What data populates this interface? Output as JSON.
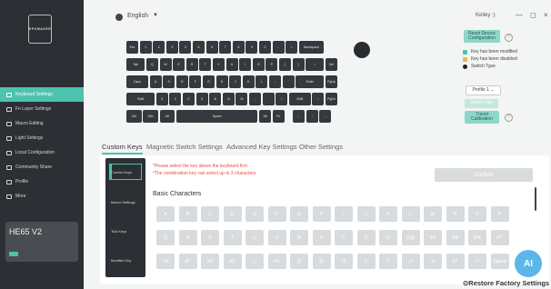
{
  "header": {
    "language": "English",
    "username": "Kelley :)"
  },
  "sidebar": {
    "logo_text": "EPOMAKER",
    "items": [
      {
        "label": "Keyboard Settings",
        "active": true
      },
      {
        "label": "Fn Layer Settings",
        "active": false
      },
      {
        "label": "Macro Editing",
        "active": false
      },
      {
        "label": "Light Settings",
        "active": false
      },
      {
        "label": "Local Configuration",
        "active": false
      },
      {
        "label": "Community Share",
        "active": false
      },
      {
        "label": "Profile",
        "active": false
      },
      {
        "label": "More",
        "active": false
      }
    ],
    "device": "HE65 V2"
  },
  "keyboard": {
    "rows": [
      [
        "Esc",
        "1",
        "2",
        "3",
        "4",
        "5",
        "6",
        "7",
        "8",
        "9",
        "0",
        "-",
        "=",
        "Backspace"
      ],
      [
        "Tab",
        "Q",
        "W",
        "E",
        "R",
        "T",
        "Y",
        "U",
        "I",
        "O",
        "P",
        "[",
        "]",
        "\\",
        "Del"
      ],
      [
        "Caps",
        "A",
        "S",
        "D",
        "F",
        "G",
        "H",
        "J",
        "K",
        "L",
        ";",
        "'",
        "Enter",
        "PgUp"
      ],
      [
        "Shift",
        "Z",
        "X",
        "C",
        "V",
        "B",
        "N",
        "M",
        ",",
        ".",
        "/",
        "Shift",
        "↑",
        "PgDn"
      ],
      [
        "Ctrl",
        "Win",
        "Alt",
        "Space",
        "Alt",
        "Fn",
        "←",
        "↓",
        "→"
      ]
    ]
  },
  "right_panel": {
    "reset_label": "Reset Device Configuration",
    "legend": [
      {
        "label": "Key has been modified",
        "color": "#4cc3ae"
      },
      {
        "label": "Key has been disabled",
        "color": "#e9b94a"
      },
      {
        "label": "Switch Type",
        "color": "#222222"
      }
    ],
    "profile": "Profile 1",
    "switch_key_label": "Switch Key",
    "travel_label": "Travel Calibration"
  },
  "tabs": [
    "Custom Keys",
    "Magnetic Switch Settings",
    "Advanced Key Settings",
    "Other Settings"
  ],
  "left_menu": [
    "Combo Keys",
    "Macro Settings",
    "Tick Keys",
    "Modifier Key"
  ],
  "notices": [
    "*Please select the key above the keyboard first",
    "*The combination key can select up to 3 characters"
  ],
  "confirm_label": "Confirm",
  "basic_title": "Basic Characters",
  "basic_rows": [
    [
      "A",
      "B",
      "C",
      "D",
      "E",
      "F",
      "G",
      "H",
      "I",
      "J",
      "K",
      "L",
      "M",
      "N",
      "O",
      "P"
    ],
    [
      "Q",
      "R",
      "S",
      "T",
      "U",
      "V",
      "W",
      "X",
      "Y",
      "Z",
      "1/!",
      "2/@",
      "3/#",
      "4/$",
      "5/%",
      "6/^"
    ],
    [
      "7/&",
      "8/*",
      "9/(",
      "0/)",
      "-/_",
      "=/+",
      "[/{",
      "]/}",
      "\\/|",
      ";/:",
      "'/\"",
      ",/<",
      "./>",
      "//?",
      "`/~",
      "Space"
    ]
  ],
  "assistant_label": "AI",
  "restore_label": "Restore Factory Settings"
}
